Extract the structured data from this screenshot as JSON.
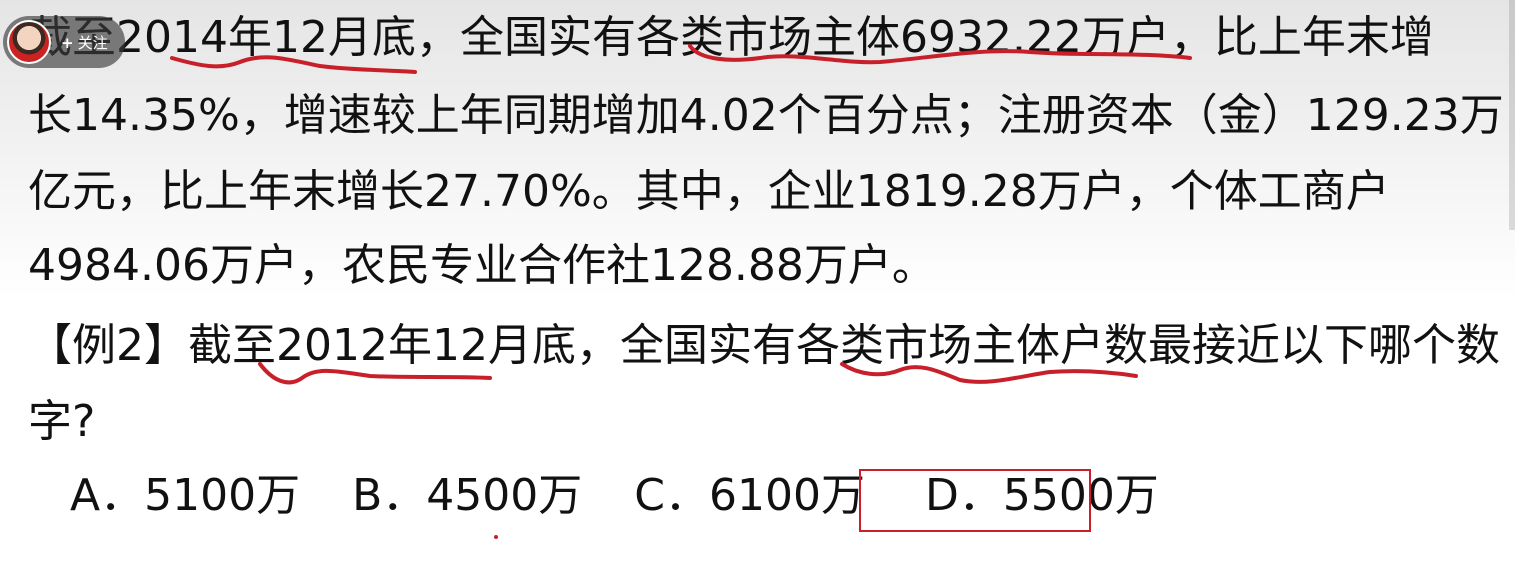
{
  "overlay": {
    "follow_plus": "+",
    "follow_label": "关注"
  },
  "passage": {
    "line1": "截至2014年12月底，全国实有各类市场主体6932.22万户，比上年末增",
    "line2": "长14.35%，增速较上年同期增加4.02个百分点；注册资本（金）129.23万",
    "line3": "亿元，比上年末增长27.70%。其中，企业1819.28万户，个体工商户",
    "line4": "4984.06万户，农民专业合作社128.88万户。"
  },
  "question": {
    "line1": "【例2】截至2012年12月底，全国实有各类市场主体户数最接近以下哪个数",
    "line2": "字?"
  },
  "options": {
    "a": "A．5100万",
    "b": "B．4500万",
    "c": "C．6100万",
    "d": "D．5500万"
  },
  "colors": {
    "ink": "#c8202a",
    "text": "#111111"
  },
  "icons": {
    "avatar": "user-avatar",
    "stray_mark": "red-dot-mark"
  }
}
